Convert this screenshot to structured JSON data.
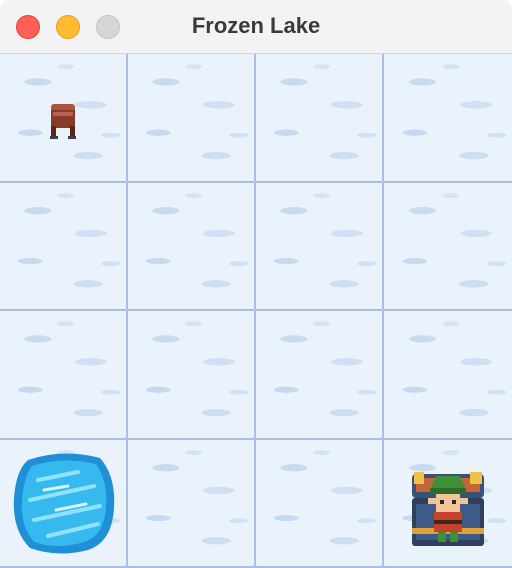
{
  "window": {
    "title": "Frozen Lake",
    "controls": [
      "close",
      "minimize",
      "zoom"
    ]
  },
  "board": {
    "rows": 4,
    "cols": 4,
    "tiles": [
      [
        "start",
        "frozen",
        "frozen",
        "frozen"
      ],
      [
        "frozen",
        "frozen",
        "frozen",
        "frozen"
      ],
      [
        "frozen",
        "frozen",
        "frozen",
        "frozen"
      ],
      [
        "hole",
        "frozen",
        "frozen",
        "goal"
      ]
    ],
    "agent": {
      "row": 3,
      "col": 3
    },
    "icons": {
      "start": "stool-icon",
      "hole": "ice-hole-icon",
      "agent": "elf-icon",
      "goal": "treasure-chest-icon"
    }
  },
  "colors": {
    "ice": "#eaf2fb",
    "grid": "#a9bfe0",
    "hole_water": "#31b4ea",
    "stool": "#8a3a2a",
    "chest": "#3a5278",
    "elf_hat": "#3f8f3a"
  }
}
